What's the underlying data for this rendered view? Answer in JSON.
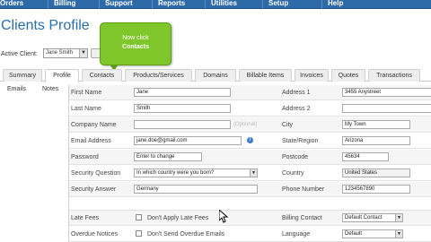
{
  "nav": {
    "items": [
      "Orders",
      "Billing",
      "Support",
      "Reports",
      "Utilities",
      "Setup",
      "Help"
    ]
  },
  "page": {
    "title": "Clients Profile"
  },
  "active_client": {
    "label": "Active Client:",
    "value": "Jane Smith"
  },
  "tooltip": {
    "line1": "Now click",
    "line2": "Contacts"
  },
  "tabs": [
    "Summary",
    "Profile",
    "Contacts",
    "Products/Services",
    "Domains",
    "Billable Items",
    "Invoices",
    "Quotes",
    "Transactions"
  ],
  "subtabs": [
    "Emails",
    "Notes"
  ],
  "form": {
    "left": {
      "first_name": {
        "label": "First Name",
        "value": "Jane"
      },
      "last_name": {
        "label": "Last Name",
        "value": "Smith"
      },
      "company_name": {
        "label": "Company Name",
        "value": "",
        "hint": "(Optional)"
      },
      "email": {
        "label": "Email Address",
        "value": "jane.doe@gmail.com"
      },
      "password": {
        "label": "Password",
        "value": "Enter to change"
      },
      "security_question": {
        "label": "Security Question",
        "value": "In which country were you born?"
      },
      "security_answer": {
        "label": "Security Answer",
        "value": "Germany"
      },
      "late_fees": {
        "label": "Late Fees",
        "option": "Don't Apply Late Fees"
      },
      "overdue_notices": {
        "label": "Overdue Notices",
        "option": "Don't Send Overdue Emails"
      }
    },
    "right": {
      "address1": {
        "label": "Address 1",
        "value": "3455 Anystreet"
      },
      "address2": {
        "label": "Address 2",
        "value": ""
      },
      "city": {
        "label": "City",
        "value": "My Town"
      },
      "state": {
        "label": "State/Region",
        "value": "Arizona"
      },
      "postcode": {
        "label": "Postcode",
        "value": "45634"
      },
      "country": {
        "label": "Country",
        "value": "United States"
      },
      "phone": {
        "label": "Phone Number",
        "value": "1234567890"
      },
      "billing_contact": {
        "label": "Billing Contact",
        "value": "Default Contact"
      },
      "language": {
        "label": "Language",
        "value": "Default"
      }
    }
  },
  "colors": {
    "nav_bg": "#2f6aa8",
    "title": "#2a6ea7",
    "tooltip_bg": "#7fc62b",
    "info_icon": "#3d7fc4"
  },
  "icons": {
    "info": "info-icon",
    "cursor": "cursor-arrow-icon"
  }
}
